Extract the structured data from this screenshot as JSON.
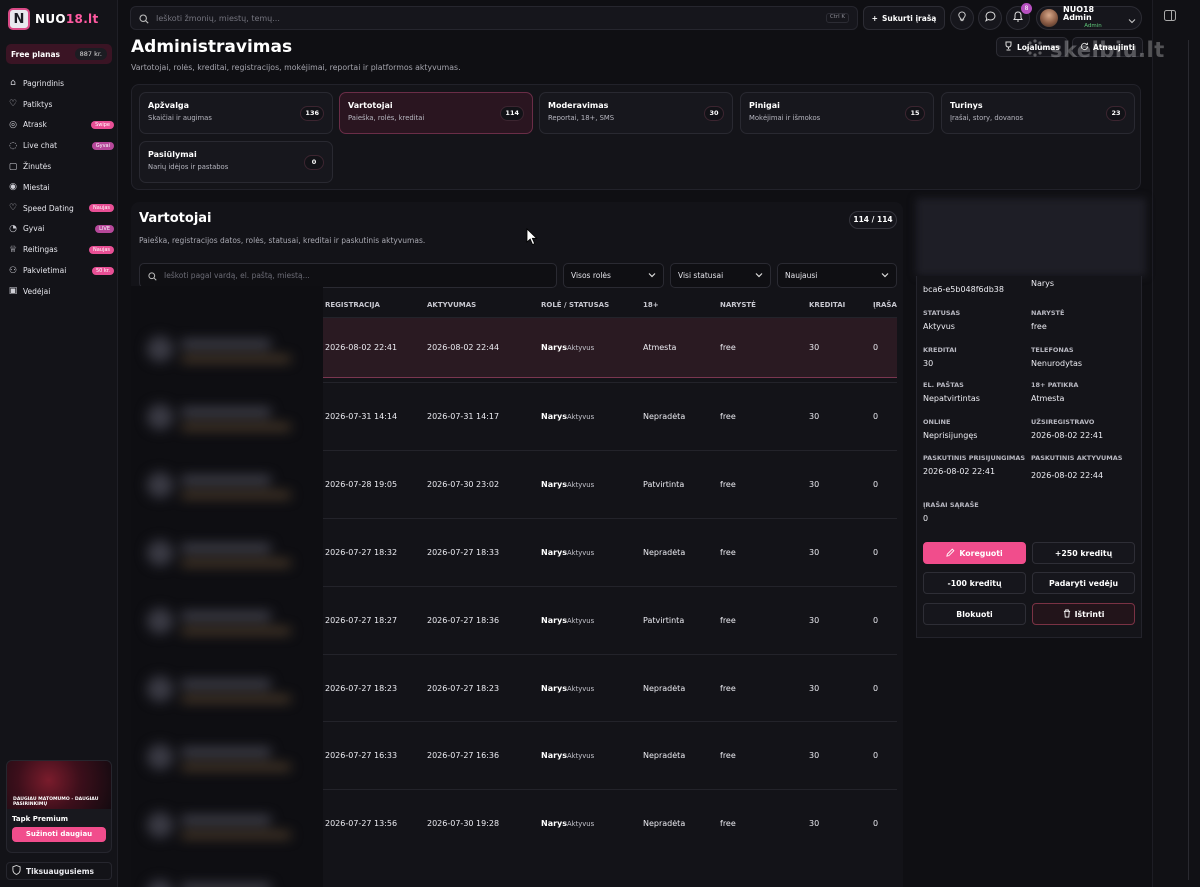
{
  "brand": {
    "logo_letter": "N",
    "logo_text_1": "NUO",
    "logo_text_2": "18.lt"
  },
  "plan": {
    "label": "Free planas",
    "price": "887 kr."
  },
  "sidebar": {
    "items": [
      {
        "label": "Pagrindinis",
        "icon": "home-icon",
        "glyph": "⌂",
        "badge": ""
      },
      {
        "label": "Patiktys",
        "icon": "heart-icon",
        "glyph": "♡",
        "badge": ""
      },
      {
        "label": "Atrask",
        "icon": "compass-icon",
        "glyph": "◎",
        "badge": "Swipe"
      },
      {
        "label": "Live chat",
        "icon": "chat-icon",
        "glyph": "◌",
        "badge": "Gyvai"
      },
      {
        "label": "Žinutės",
        "icon": "message-icon",
        "glyph": "▢",
        "badge": ""
      },
      {
        "label": "Miestai",
        "icon": "location-icon",
        "glyph": "◉",
        "badge": ""
      },
      {
        "label": "Speed Dating",
        "icon": "heart-icon",
        "glyph": "♡",
        "badge": "Naujas"
      },
      {
        "label": "Gyvai",
        "icon": "radio-icon",
        "glyph": "◔",
        "badge": "LIVE"
      },
      {
        "label": "Reitingas",
        "icon": "trophy-icon",
        "glyph": "♕",
        "badge": "Naujas"
      },
      {
        "label": "Pakvietimai",
        "icon": "user-plus-icon",
        "glyph": "⚇",
        "badge": "50 kr."
      },
      {
        "label": "Vedėjai",
        "icon": "camera-icon",
        "glyph": "▣",
        "badge": ""
      }
    ],
    "promo": {
      "caption": "DAUGIAU MATOMUMO - DAUGIAU PASIRINKIMŲ",
      "title": "Tapk Premium",
      "button": "Sužinoti daugiau"
    },
    "updates": {
      "label": "Tiksuaugusiems",
      "icon": "shield-icon"
    }
  },
  "topbar": {
    "search_placeholder": "Ieškoti žmonių, miestų, temų...",
    "shortcut": "Ctrl K",
    "create_label": "Sukurti įrašą",
    "notif_count": "8",
    "user_name": "NUO18 Admin",
    "user_role": "Admin"
  },
  "header": {
    "title": "Administravimas",
    "subtitle": "Vartotojai, rolės, kreditai, registracijos, mokėjimai, reportai ir platformos aktyvumas.",
    "btn_loyalty": "Lojalumas",
    "btn_refresh": "Atnaujinti"
  },
  "sections": [
    {
      "title": "Apžvalga",
      "sub": "Skaičiai ir augimas",
      "count": "136",
      "active": false
    },
    {
      "title": "Vartotojai",
      "sub": "Paieška, rolės, kreditai",
      "count": "114",
      "active": true
    },
    {
      "title": "Moderavimas",
      "sub": "Reportai, 18+, SMS",
      "count": "30",
      "active": false
    },
    {
      "title": "Pinigai",
      "sub": "Mokėjimai ir išmokos",
      "count": "15",
      "active": false
    },
    {
      "title": "Turinys",
      "sub": "Įrašai, story, dovanos",
      "count": "23",
      "active": false
    },
    {
      "title": "Pasiūlymai",
      "sub": "Narių idėjos ir pastabos",
      "count": "0",
      "active": false
    }
  ],
  "users": {
    "title": "Vartotojai",
    "subtitle": "Paieška, registracijos datos, rolės, statusai, kreditai ir paskutinis aktyvumas.",
    "count": "114 / 114",
    "search_placeholder": "Ieškoti pagal vardą, el. paštą, miestą...",
    "filters": [
      "Visos rolės",
      "Visi statusai",
      "Naujausi"
    ],
    "columns": [
      "REGISTRACIJA",
      "AKTYVUMAS",
      "ROLĖ / STATUSAS",
      "18+",
      "NARYSTĖ",
      "KREDITAI",
      "ĮRAŠA"
    ],
    "rows": [
      {
        "reg": "2026-08-02 22:41",
        "act": "2026-08-02 22:44",
        "role": "Narys",
        "status": "Aktyvus",
        "age": "Atmesta",
        "member": "free",
        "credits": "30",
        "posts": "0",
        "selected": true
      },
      {
        "reg": "2026-07-31 14:14",
        "act": "2026-07-31 14:17",
        "role": "Narys",
        "status": "Aktyvus",
        "age": "Nepradėta",
        "member": "free",
        "credits": "30",
        "posts": "0",
        "selected": false
      },
      {
        "reg": "2026-07-28 19:05",
        "act": "2026-07-30 23:02",
        "role": "Narys",
        "status": "Aktyvus",
        "age": "Patvirtinta",
        "member": "free",
        "credits": "30",
        "posts": "0",
        "selected": false
      },
      {
        "reg": "2026-07-27 18:32",
        "act": "2026-07-27 18:33",
        "role": "Narys",
        "status": "Aktyvus",
        "age": "Nepradėta",
        "member": "free",
        "credits": "30",
        "posts": "0",
        "selected": false
      },
      {
        "reg": "2026-07-27 18:27",
        "act": "2026-07-27 18:36",
        "role": "Narys",
        "status": "Aktyvus",
        "age": "Patvirtinta",
        "member": "free",
        "credits": "30",
        "posts": "0",
        "selected": false
      },
      {
        "reg": "2026-07-27 18:23",
        "act": "2026-07-27 18:23",
        "role": "Narys",
        "status": "Aktyvus",
        "age": "Nepradėta",
        "member": "free",
        "credits": "30",
        "posts": "0",
        "selected": false
      },
      {
        "reg": "2026-07-27 16:33",
        "act": "2026-07-27 16:36",
        "role": "Narys",
        "status": "Aktyvus",
        "age": "Nepradėta",
        "member": "free",
        "credits": "30",
        "posts": "0",
        "selected": false
      },
      {
        "reg": "2026-07-27 13:56",
        "act": "2026-07-30 19:28",
        "role": "Narys",
        "status": "Aktyvus",
        "age": "Nepradėta",
        "member": "free",
        "credits": "30",
        "posts": "0",
        "selected": false
      }
    ]
  },
  "detail": {
    "id_value": "bca6-e5b048f6db38",
    "role_value": "Narys",
    "fields": [
      {
        "label": "Statusas",
        "value": "Aktyvus"
      },
      {
        "label": "Narystė",
        "value": "free"
      },
      {
        "label": "Kreditai",
        "value": "30"
      },
      {
        "label": "Telefonas",
        "value": "Nenurodytas"
      },
      {
        "label": "El. paštas",
        "value": "Nepatvirtintas"
      },
      {
        "label": "18+ patikra",
        "value": "Atmesta"
      },
      {
        "label": "Online",
        "value": "Neprisijungęs"
      },
      {
        "label": "Užsiregistravo",
        "value": "2026-08-02 22:41"
      },
      {
        "label": "Paskutinis prisijungimas",
        "value": "2026-08-02 22:41"
      },
      {
        "label": "Paskutinis aktyvumas",
        "value": "2026-08-02 22:44"
      },
      {
        "label": "Įrašai sąraše",
        "value": "0"
      }
    ],
    "actions": {
      "edit": "Koreguoti",
      "plus": "+250 kreditų",
      "minus": "-100 kreditų",
      "host": "Padaryti vedėju",
      "block": "Blokuoti",
      "delete": "Ištrinti"
    }
  },
  "watermark": "skelbiu.lt",
  "colors": {
    "accent": "#f14d8c",
    "bg": "#0f0f13",
    "panel": "#141419"
  }
}
